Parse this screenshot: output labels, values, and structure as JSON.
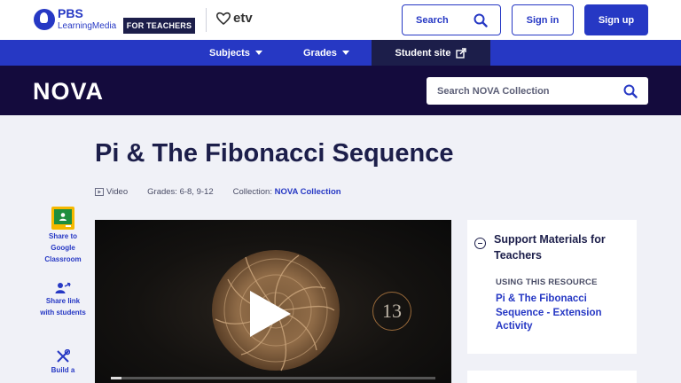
{
  "header": {
    "brand_name": "PBS",
    "brand_sub": "LearningMedia",
    "for_teachers": "FOR TEACHERS",
    "partner_name": "etv",
    "search_label": "Search",
    "signin_label": "Sign in",
    "signup_label": "Sign up",
    "accent_color": "#2638c4"
  },
  "nav": {
    "subjects_label": "Subjects",
    "grades_label": "Grades",
    "student_site_label": "Student site"
  },
  "collection_bar": {
    "logo_text": "NOVA",
    "search_placeholder": "Search NOVA Collection",
    "background_color": "#140b3d"
  },
  "resource": {
    "title": "Pi & The Fibonacci Sequence",
    "media_type": "Video",
    "grades": "Grades: 6-8, 9-12",
    "collection_prefix": "Collection:",
    "collection_name": "NOVA Collection"
  },
  "share": {
    "google_classroom_label": "Share to Google Classroom",
    "share_link_label": "Share link with students",
    "build_label": "Build a"
  },
  "video": {
    "overlay_number": "13"
  },
  "support": {
    "title": "Support Materials for Teachers",
    "section_heading": "USING THIS RESOURCE",
    "link_text": "Pi & The Fibonacci Sequence - Extension Activity"
  }
}
